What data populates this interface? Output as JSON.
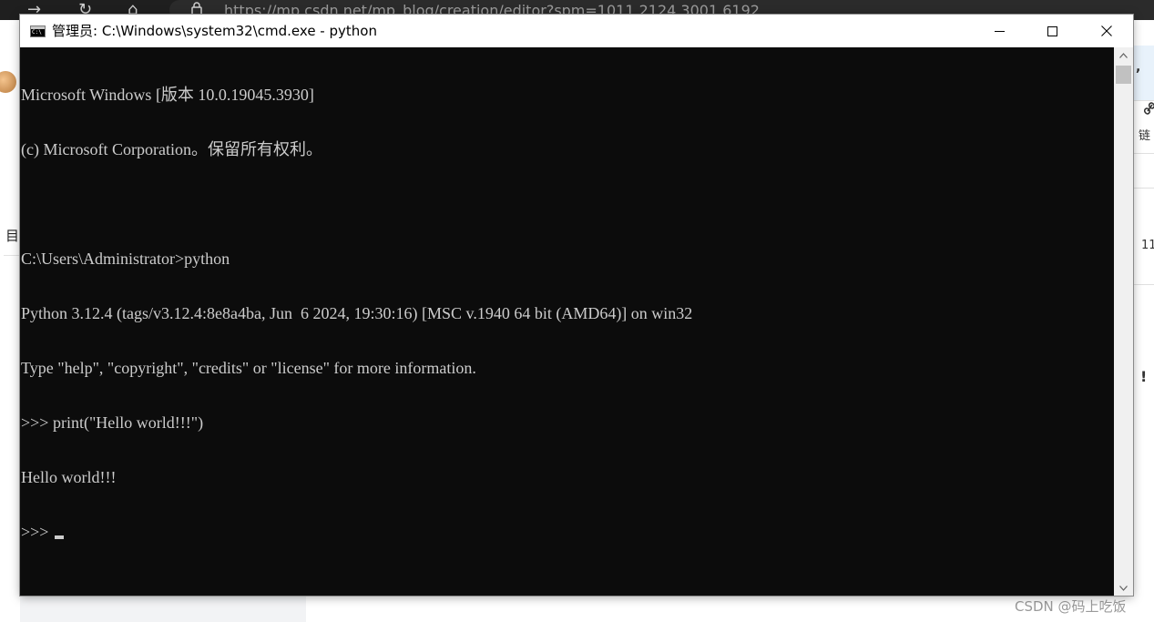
{
  "browser": {
    "url": "https://mp.csdn.net/mp_blog/creation/editor?spm=1011.2124.3001.6192"
  },
  "background": {
    "left_label": "目",
    "right_labels": [
      ",",
      "链",
      "11",
      "!"
    ],
    "watermark": "CSDN @码上吃饭"
  },
  "window": {
    "title": "管理员: C:\\Windows\\system32\\cmd.exe - python",
    "controls": {
      "minimize_icon": "minimize-icon",
      "maximize_icon": "maximize-icon",
      "close_icon": "close-icon"
    }
  },
  "console": {
    "lines": [
      "Microsoft Windows [版本 10.0.19045.3930]",
      "(c) Microsoft Corporation。保留所有权利。",
      "",
      "C:\\Users\\Administrator>python",
      "Python 3.12.4 (tags/v3.12.4:8e8a4ba, Jun  6 2024, 19:30:16) [MSC v.1940 64 bit (AMD64)] on win32",
      "Type \"help\", \"copyright\", \"credits\" or \"license\" for more information.",
      ">>> print(\"Hello world!!!\")",
      "Hello world!!!"
    ],
    "prompt": ">>> "
  },
  "colors": {
    "console_bg": "#0c0c0c",
    "console_fg": "#cccccc",
    "titlebar_bg": "#ffffff"
  }
}
